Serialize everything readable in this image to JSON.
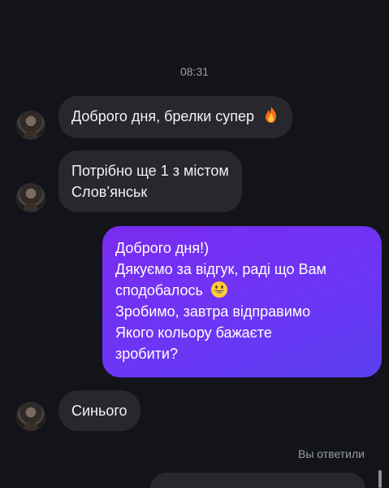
{
  "thread": {
    "timestamp": "08:31",
    "messages": [
      {
        "from": "them",
        "text": "Доброго дня, брелки супер",
        "emoji": "fire-emoji"
      },
      {
        "from": "them",
        "lines": [
          "Потрібно ще 1 з містом",
          "Слов’янськ"
        ]
      },
      {
        "from": "me",
        "lines": [
          "Доброго дня!)",
          "Дякуємо за відгук, раді що Вам",
          "сподобалось",
          "Зробимо, завтра відправимо",
          "Якого кольору бажаєте",
          "зробити?"
        ],
        "emoji": "grinning-face-emoji"
      },
      {
        "from": "them",
        "text": "Синього"
      }
    ],
    "replied_label": "Вы ответили"
  },
  "colors": {
    "background": "#121419",
    "incoming_bubble": "#26282e",
    "outgoing_bubble": "#6d35f5",
    "meta_text": "#9a9da6"
  }
}
